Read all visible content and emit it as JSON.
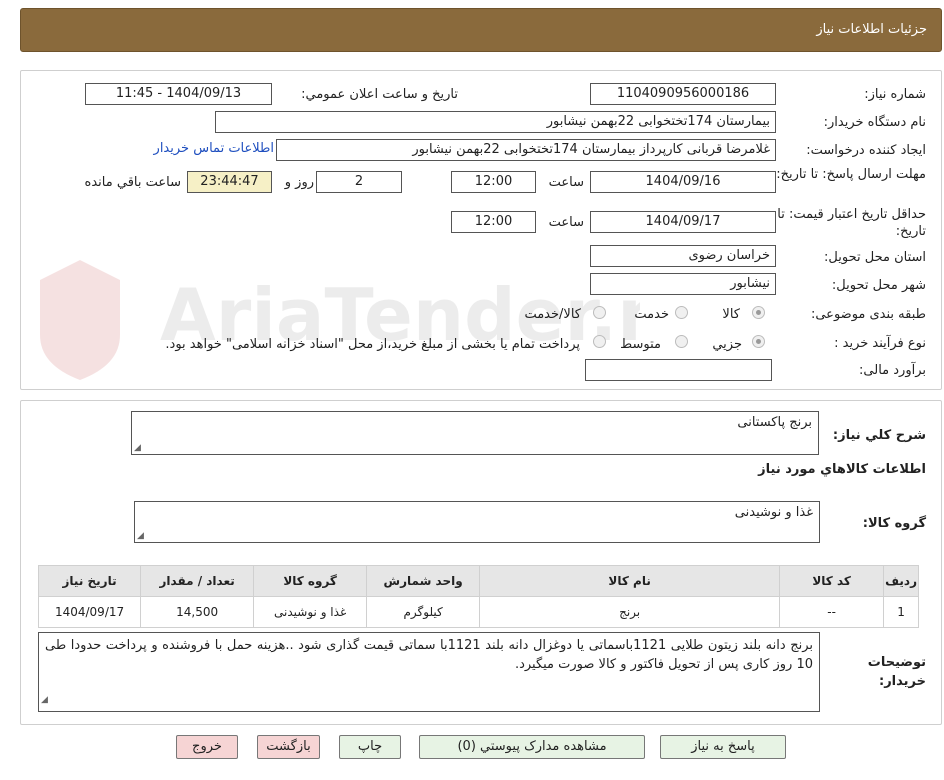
{
  "header": {
    "title": "جزئیات اطلاعات نیاز"
  },
  "watermark": {
    "text": "AriaTender.neT"
  },
  "form": {
    "need_number_label": "شماره نیاز:",
    "need_number": "1104090956000186",
    "announce_label": "تاريخ و ساعت اعلان عمومي:",
    "announce_value": "1404/09/13 - 11:45",
    "buyer_org_label": "نام دستگاه خريدار:",
    "buyer_org": "بیمارستان 174تختخوابی 22بهمن نیشابور",
    "requester_label": "ايجاد کننده درخواست:",
    "requester": "غلامرضا قربانی کارپرداز بیمارستان 174تختخوابی 22بهمن نیشابور",
    "contact_link": "اطلاعات تماس خريدار",
    "deadline_label": "مهلت ارسال پاسخ: تا تاريخ:",
    "deadline_date": "1404/09/16",
    "time_label": "ساعت",
    "deadline_time": "12:00",
    "days_value": "2",
    "days_label": "روز و",
    "remaining_time": "23:44:47",
    "remaining_label": "ساعت باقي مانده",
    "validity_label": "حداقل تاريخ اعتبار قيمت: تا تاريخ:",
    "validity_date": "1404/09/17",
    "validity_time": "12:00",
    "province_label": "استان محل تحويل:",
    "province": "خراسان رضوی",
    "city_label": "شهر محل تحويل:",
    "city": "نیشابور",
    "category_label": "طبقه بندی موضوعی:",
    "category_options": [
      "کالا",
      "خدمت",
      "کالا/خدمت"
    ],
    "process_label": "نوع فرآيند خريد :",
    "process_options": [
      "جزيي",
      "متوسط"
    ],
    "process_note": "پرداخت تمام یا بخشی از مبلغ خرید،از محل \"اسناد خزانه اسلامی\" خواهد بود.",
    "estimate_label": "برآورد مالی:",
    "estimate": ""
  },
  "summary": {
    "label": "شرح کلي نياز:",
    "value": "برنج پاکستانی",
    "items_title": "اطلاعات کالاهاي مورد نياز",
    "group_label": "گروه کالا:",
    "group_value": "غذا و نوشیدنی"
  },
  "table": {
    "headers": [
      "رديف",
      "کد کالا",
      "نام کالا",
      "واحد شمارش",
      "گروه کالا",
      "تعداد / مقدار",
      "تاريخ نياز"
    ],
    "rows": [
      [
        "1",
        "--",
        "برنج",
        "کیلوگرم",
        "غذا و نوشیدنی",
        "14,500",
        "1404/09/17"
      ]
    ]
  },
  "notes": {
    "label_1": "توضيحات",
    "label_2": "خريدار:",
    "text": "برنج دانه بلند زیتون طلایی 1121باسماتی یا دوغزال دانه بلند 1121با سماتی قیمت گذاری شود ..هزینه حمل با فروشنده و پرداخت حدودا طی 10 روز کاری پس از تحویل فاکتور و کالا صورت  میگیرد."
  },
  "buttons": {
    "reply": "پاسخ به نياز",
    "docs": "مشاهده مدارک پيوستي (0)",
    "print": "چاپ",
    "back": "بازگشت",
    "exit": "خروج"
  }
}
